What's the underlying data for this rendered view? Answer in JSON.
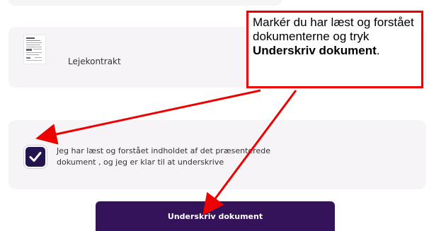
{
  "document": {
    "name": "Lejekontrakt",
    "thumbnail_icon": "document-thumbnail-icon"
  },
  "consent": {
    "checked": true,
    "checkbox_icon": "check-icon",
    "text_line_1": "Jeg har læst og forstået indholdet af det præsenterede",
    "text_line_2": "dokument , og jeg er klar til at underskrive"
  },
  "sign_button": {
    "label": "Underskriv dokument"
  },
  "instruction": {
    "text_part_1": "Markér du har læst og forstået dokumenterne og tryk ",
    "bold_part_1": "Underskriv dokument",
    "text_part_2": "."
  },
  "colors": {
    "card_background": "#f6f4f6",
    "accent_dark_purple": "#35135b",
    "checkbox_purple": "#24154f",
    "annotation_red": "#ee0000"
  }
}
